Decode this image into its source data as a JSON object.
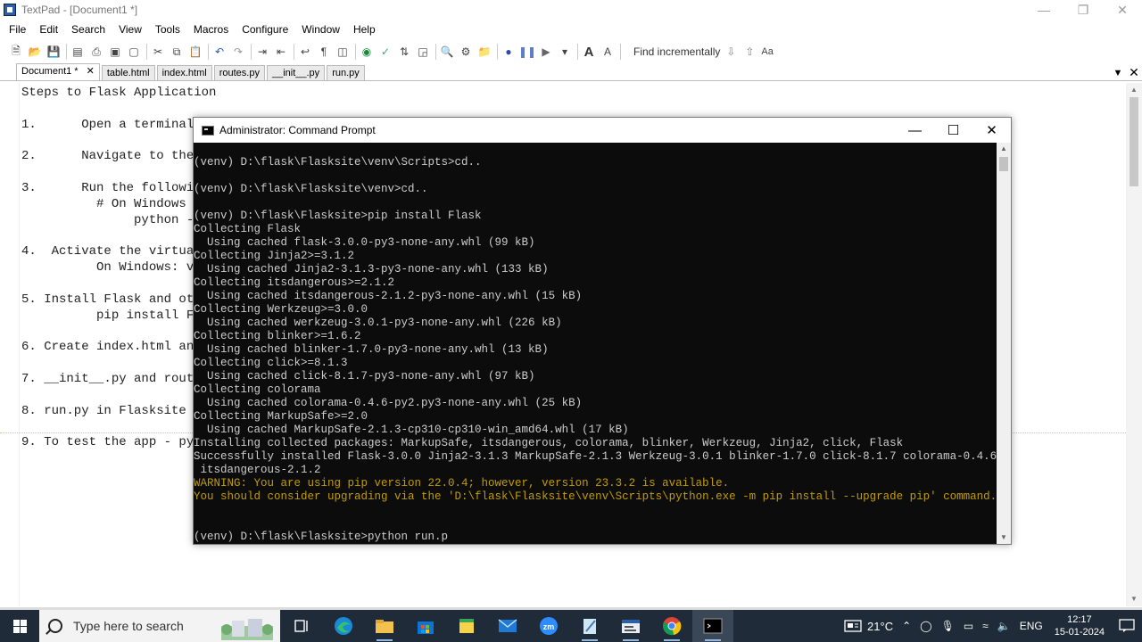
{
  "textpad": {
    "title": "TextPad - [Document1 *]",
    "menu": [
      "File",
      "Edit",
      "Search",
      "View",
      "Tools",
      "Macros",
      "Configure",
      "Window",
      "Help"
    ],
    "find_label": "Find incrementally",
    "match_case_label": "Aa",
    "tabs": [
      "Document1 *",
      "table.html",
      "index.html",
      "routes.py",
      "__init__.py",
      "run.py"
    ],
    "editor_lines": [
      "Steps to Flask Application",
      "1.      Open a terminal",
      "2.      Navigate to the",
      "3.      Run the followi",
      "          # On Windows",
      "               python -",
      "4.  Activate the virtua",
      "          On Windows: v",
      "5. Install Flask and ot",
      "          pip install F",
      "6. Create index.html an",
      "7. __init__.py and rout",
      "8. run.py in Flasksite",
      "9. To test the app - py"
    ]
  },
  "cmd": {
    "title": "Administrator: Command Prompt",
    "lines": [
      "(venv) D:\\flask\\Flasksite\\venv\\Scripts>cd..",
      "(venv) D:\\flask\\Flasksite\\venv>cd..",
      "(venv) D:\\flask\\Flasksite>pip install Flask",
      "Collecting Flask",
      "  Using cached flask-3.0.0-py3-none-any.whl (99 kB)",
      "Collecting Jinja2>=3.1.2",
      "  Using cached Jinja2-3.1.3-py3-none-any.whl (133 kB)",
      "Collecting itsdangerous>=2.1.2",
      "  Using cached itsdangerous-2.1.2-py3-none-any.whl (15 kB)",
      "Collecting Werkzeug>=3.0.0",
      "  Using cached werkzeug-3.0.1-py3-none-any.whl (226 kB)",
      "Collecting blinker>=1.6.2",
      "  Using cached blinker-1.7.0-py3-none-any.whl (13 kB)",
      "Collecting click>=8.1.3",
      "  Using cached click-8.1.7-py3-none-any.whl (97 kB)",
      "Collecting colorama",
      "  Using cached colorama-0.4.6-py2.py3-none-any.whl (25 kB)",
      "Collecting MarkupSafe>=2.0",
      "  Using cached MarkupSafe-2.1.3-cp310-cp310-win_amd64.whl (17 kB)",
      "Installing collected packages: MarkupSafe, itsdangerous, colorama, blinker, Werkzeug, Jinja2, click, Flask",
      "Successfully installed Flask-3.0.0 Jinja2-3.1.3 MarkupSafe-2.1.3 Werkzeug-3.0.1 blinker-1.7.0 click-8.1.7 colorama-0.4.6",
      " itsdangerous-2.1.2",
      "WARNING: You are using pip version 22.0.4; however, version 23.3.2 is available.",
      "You should consider upgrading via the 'D:\\flask\\Flasksite\\venv\\Scripts\\python.exe -m pip install --upgrade pip' command.",
      "(venv) D:\\flask\\Flasksite>python run.p"
    ]
  },
  "taskbar": {
    "search_placeholder": "Type here to search",
    "temperature": "21°C",
    "language": "ENG",
    "time": "12:17",
    "date": "15-01-2024"
  },
  "colors": {
    "cmd_background": "#0c0c0c",
    "cmd_text": "#cccccc",
    "cmd_warning": "#c19c00",
    "taskbar": "#1f2b38"
  }
}
